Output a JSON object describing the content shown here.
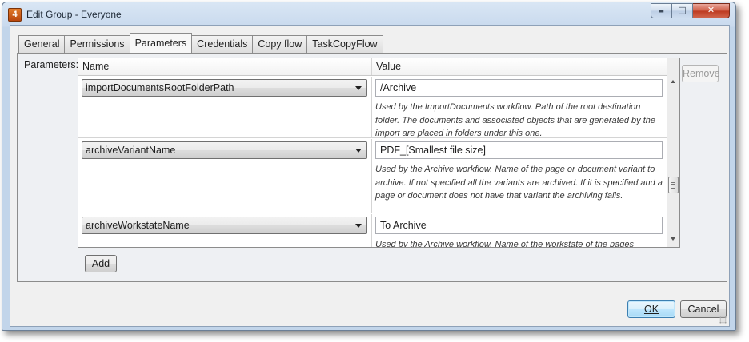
{
  "window": {
    "app_icon_text": "4",
    "title": "Edit Group - Everyone",
    "controls": {
      "minimize": "▬",
      "maximize": "□",
      "close": "✕"
    }
  },
  "tabs": [
    {
      "label": "General",
      "active": false
    },
    {
      "label": "Permissions",
      "active": false
    },
    {
      "label": "Parameters",
      "active": true
    },
    {
      "label": "Credentials",
      "active": false
    },
    {
      "label": "Copy flow",
      "active": false
    },
    {
      "label": "TaskCopyFlow",
      "active": false
    }
  ],
  "parameters": {
    "label": "Parameters:",
    "columns": {
      "name": "Name",
      "value": "Value"
    },
    "rows": [
      {
        "name": "importDocumentsRootFolderPath",
        "value": "/Archive",
        "description": "Used by the ImportDocuments workflow. Path of the root destination folder. The documents and associated objects that are generated by the import are placed in folders under this one."
      },
      {
        "name": "archiveVariantName",
        "value": "PDF_[Smallest file size]",
        "description": "Used by the Archive workflow. Name of the page or document variant to archive. If not specified all the variants are archived. If it is specified and a page or document does not have that variant the archiving fails."
      },
      {
        "name": "archiveWorkstateName",
        "value": "To Archive",
        "description": "Used by the Archive workflow. Name of the workstate of the pages"
      }
    ],
    "remove_label": "Remove",
    "add_label": "Add"
  },
  "footer": {
    "ok_label": "OK",
    "cancel_label": "Cancel"
  }
}
